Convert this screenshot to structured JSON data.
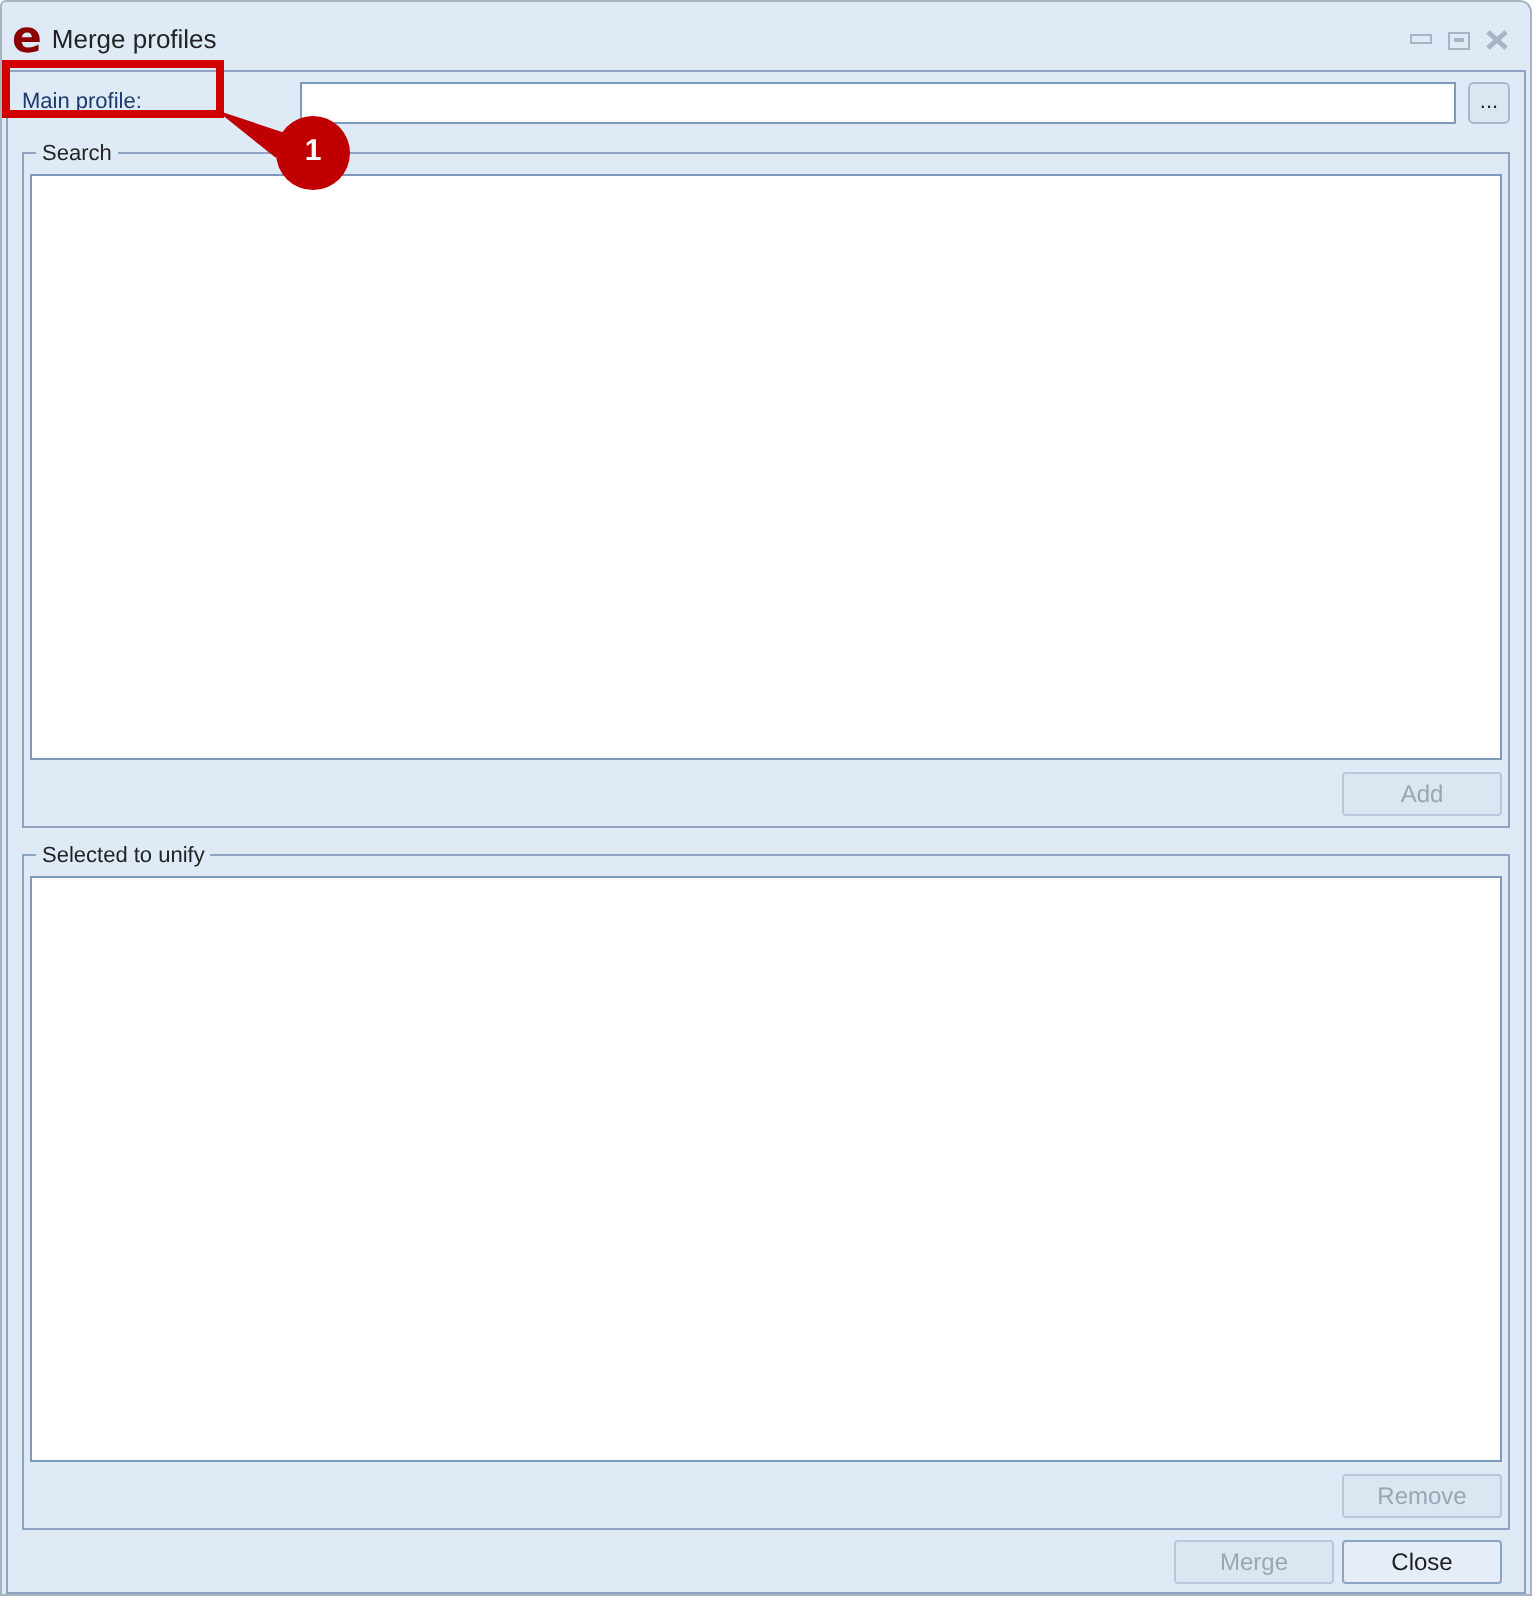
{
  "window": {
    "title": "Merge profiles",
    "app_icon": "e"
  },
  "main_profile": {
    "label": "Main profile:",
    "value_button": "..."
  },
  "search_group": {
    "title": "Search",
    "button": {
      "label": "Add",
      "disabled": true
    }
  },
  "selected_group": {
    "title": "Selected to unify",
    "button": {
      "label": "Remove",
      "disabled": true
    }
  },
  "footer_buttons": [
    {
      "label": "Merge",
      "disabled": true
    },
    {
      "label": "Close",
      "disabled": false
    }
  ],
  "callout": {
    "number": "1"
  }
}
